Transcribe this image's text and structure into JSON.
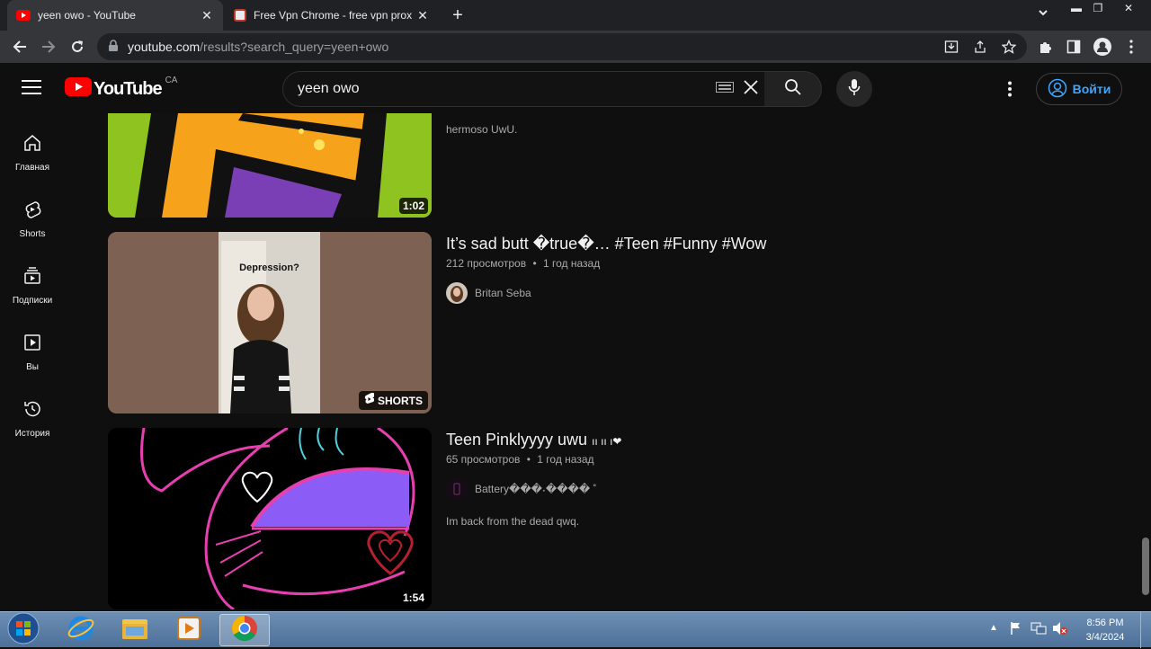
{
  "browser": {
    "tabs": [
      {
        "title": "yeen owo - YouTube",
        "active": true
      },
      {
        "title": "Free Vpn Chrome - free vpn prox",
        "active": false
      }
    ],
    "new_tab": "+",
    "url_host": "youtube.com",
    "url_path": "/results?search_query=yeen+owo"
  },
  "youtube": {
    "logo_text": "YouTube",
    "region": "CA",
    "search_value": "yeen owo",
    "sign_in": "Войти"
  },
  "sidebar": {
    "items": [
      {
        "label": "Главная",
        "icon": "home-icon"
      },
      {
        "label": "Shorts",
        "icon": "shorts-icon"
      },
      {
        "label": "Подписки",
        "icon": "subscriptions-icon"
      },
      {
        "label": "Вы",
        "icon": "library-icon"
      },
      {
        "label": "История",
        "icon": "history-icon"
      }
    ]
  },
  "results": [
    {
      "duration": "1:02",
      "description": "hermoso UwU."
    },
    {
      "title": "It’s sad butt ⁠�true�… #Teen #Funny #Wow",
      "views": "212 просмотров",
      "age": "1 год назад",
      "channel": "Britan Seba",
      "badge": "SHORTS",
      "thumb_text": "Depression?"
    },
    {
      "title": "Teen Pinklyyyy uwu",
      "title_suffix": "ıı ıı ı❤",
      "views": "65 просмотров",
      "age": "1 год назад",
      "channel": "Battery���˖���� ˚",
      "description": "Im back from the dead qwq.",
      "duration": "1:54"
    }
  ],
  "meta_separator": "•",
  "taskbar": {
    "time": "8:56 PM",
    "date": "3/4/2024"
  }
}
